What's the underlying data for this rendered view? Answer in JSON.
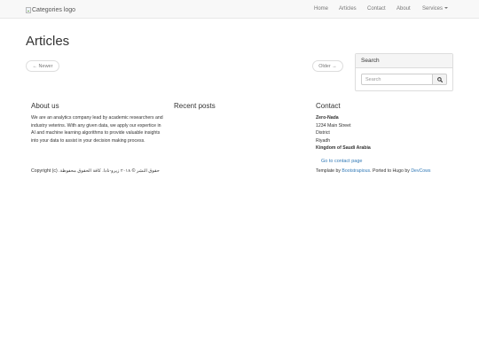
{
  "navbar": {
    "logo_alt": "Categories logo",
    "items": [
      {
        "label": "Home"
      },
      {
        "label": "Articles"
      },
      {
        "label": "Contact"
      },
      {
        "label": "About"
      },
      {
        "label": "Services"
      }
    ]
  },
  "main": {
    "title": "Articles",
    "newer_label": "← Newer",
    "older_label": "Older →"
  },
  "sidebar": {
    "search_heading": "Search",
    "search_placeholder": "Search",
    "search_icon": "search-icon"
  },
  "footer": {
    "about": {
      "heading": "About us",
      "text": "We are an analytics company lead by academic researchers and industry veterins. With any given data, we apply our expertice in AI and machine learning algorithms to provide valuable insights into your data to assist in your decision making process."
    },
    "recent_posts": {
      "heading": "Recent posts"
    },
    "contact": {
      "heading": "Contact",
      "company": "Zero-Nada",
      "street": "1234 Main Street",
      "district": "District",
      "city": "Riyadh",
      "country": "Kingdom of Saudi Arabia",
      "link": "Go to contact page"
    },
    "copyright_prefix": "Copyright (c)",
    "copyright_arabic": "حقوق النشر © ٢٠١٨ زيرو-نادا. كافة الحقوق محفوظة.",
    "credits": {
      "prefix": "Template by",
      "bootstrapious": "Bootstrapious",
      "middle": ". Ported to Hugo by",
      "devcows": "DevCows"
    }
  },
  "colors": {
    "link": "#337ab7",
    "navbar_bg": "#f8f8f8"
  }
}
